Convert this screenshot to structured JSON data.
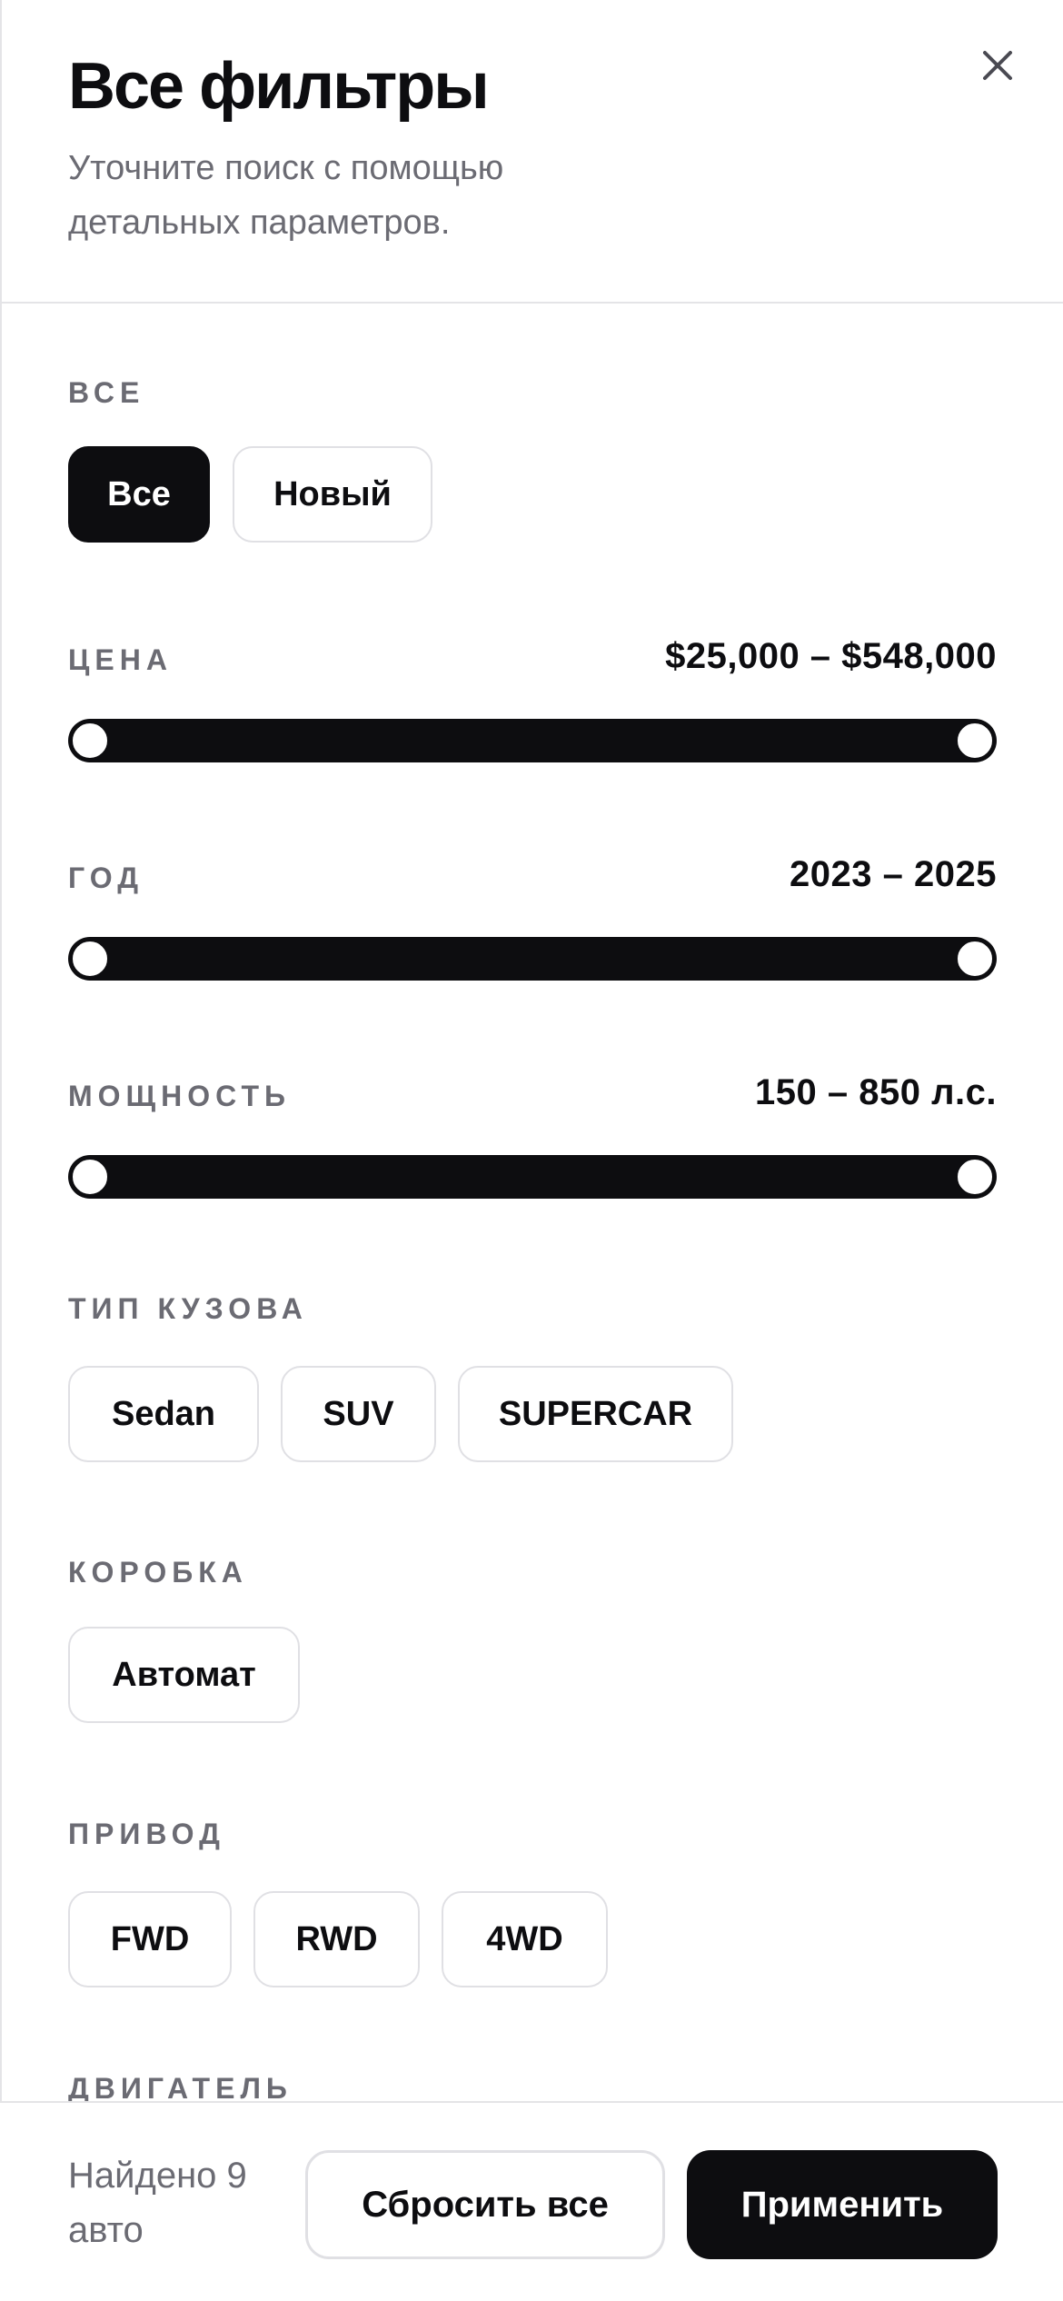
{
  "header": {
    "title": "Все фильтры",
    "subtitle": "Уточните поиск с помощью детальных параметров.",
    "close_icon": "close-icon"
  },
  "condition": {
    "label": "ВСЕ",
    "options": [
      {
        "label": "Все",
        "selected": true
      },
      {
        "label": "Новый",
        "selected": false
      }
    ]
  },
  "price": {
    "label": "ЦЕНА",
    "value_text": "$25,000 – $548,000",
    "min_fraction": 0.0,
    "max_fraction": 1.0
  },
  "year": {
    "label": "ГОД",
    "value_text": "2023 – 2025",
    "min_fraction": 0.0,
    "max_fraction": 1.0
  },
  "power": {
    "label": "МОЩНОСТЬ",
    "value_text": "150 – 850 л.с.",
    "min_fraction": 0.0,
    "max_fraction": 1.0
  },
  "body_type": {
    "label": "ТИП КУЗОВА",
    "options": [
      "Sedan",
      "SUV",
      "SUPERCAR"
    ]
  },
  "gearbox": {
    "label": "КОРОБКА",
    "options": [
      "Автомат"
    ]
  },
  "drive": {
    "label": "ПРИВОД",
    "options": [
      "FWD",
      "RWD",
      "4WD"
    ]
  },
  "engine": {
    "label": "ДВИГАТЕЛЬ"
  },
  "footer": {
    "found_text": "Найдено 9 авто",
    "reset_label": "Сбросить все",
    "apply_label": "Применить"
  },
  "colors": {
    "accent": "#0d0d10",
    "muted_text": "#6b6b73",
    "border": "#e0e0e4",
    "background": "#ffffff"
  }
}
